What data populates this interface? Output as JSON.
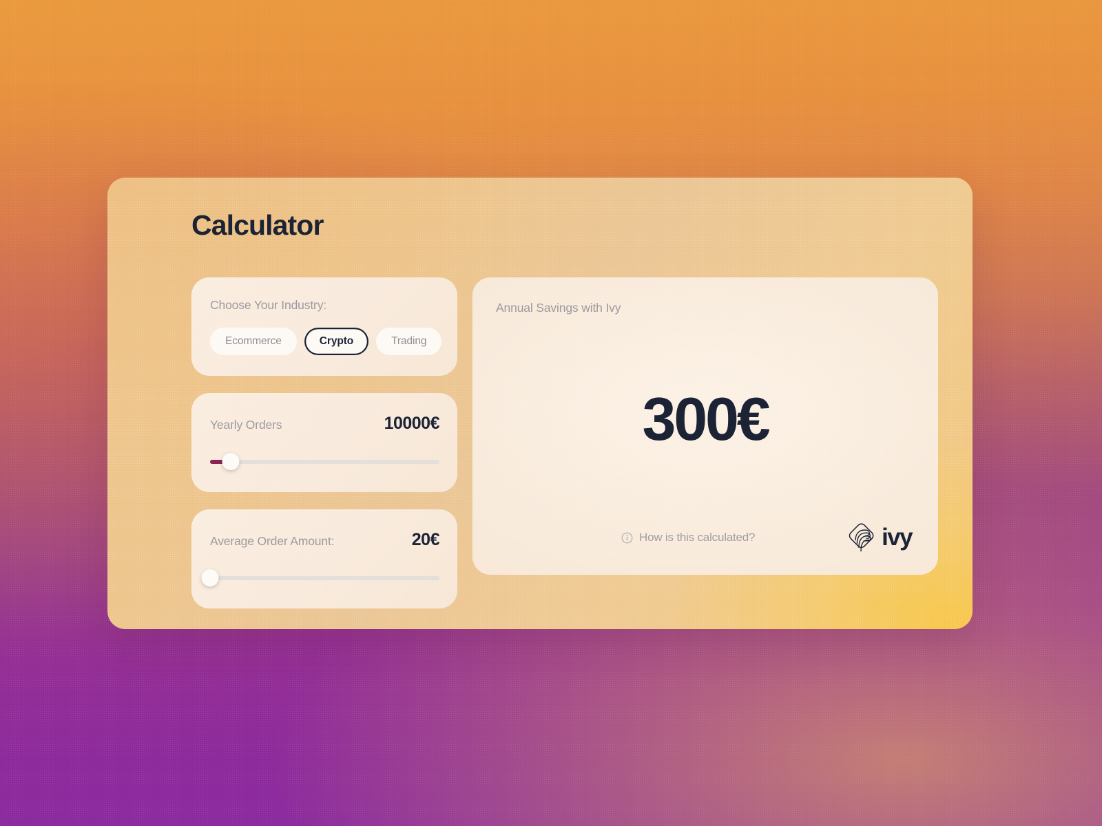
{
  "page": {
    "title": "Calculator"
  },
  "colors": {
    "accent_slider": "#8b2252",
    "text_dark": "#1b2335",
    "text_muted": "#9c9aa0",
    "card_bg": "#eec68d",
    "panel_bg": "#f9ecdd",
    "bg_top": "#e8913e",
    "bg_bottom": "#8e2a9c",
    "bg_glow": "#f3c454"
  },
  "industry": {
    "label": "Choose Your Industry:",
    "options": [
      {
        "label": "Ecommerce",
        "selected": false
      },
      {
        "label": "Crypto",
        "selected": true
      },
      {
        "label": "Trading",
        "selected": false
      }
    ],
    "selected": "Crypto"
  },
  "sliders": [
    {
      "name": "yearly-orders",
      "label": "Yearly Orders",
      "value": "10000€",
      "fill_percent": 9
    },
    {
      "name": "average-order-amount",
      "label": "Average Order Amount:",
      "value": "20€",
      "fill_percent": 0
    }
  ],
  "result": {
    "label": "Annual Savings with Ivy",
    "value": "300€",
    "how_link": "How is this calculated?",
    "info_icon": "info-circle-icon",
    "logo_word": "ivy",
    "logo_mark": "ivy-diamond-logo-icon"
  }
}
